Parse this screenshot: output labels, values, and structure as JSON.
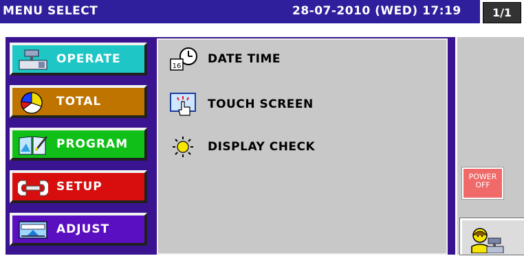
{
  "header": {
    "title": "MENU SELECT",
    "datetime": "28-07-2010 (WED) 17:19",
    "page": "1/1"
  },
  "menu": [
    {
      "id": "operate",
      "label": "OPERATE",
      "color": "#1ec6c6",
      "icon": "register-icon"
    },
    {
      "id": "total",
      "label": "TOTAL",
      "color": "#c07400",
      "icon": "pie-chart-icon"
    },
    {
      "id": "program",
      "label": "PROGRAM",
      "color": "#10c018",
      "icon": "book-pen-icon"
    },
    {
      "id": "setup",
      "label": "SETUP",
      "color": "#d80e0e",
      "icon": "wrench-icon"
    },
    {
      "id": "adjust",
      "label": "ADJUST",
      "color": "#5a0fc0",
      "icon": "keyboard-icon"
    }
  ],
  "items": [
    {
      "id": "date-time",
      "label": "DATE TIME",
      "icon": "clock-calendar-icon"
    },
    {
      "id": "touch-screen",
      "label": "TOUCH SCREEN",
      "icon": "touch-hand-icon"
    },
    {
      "id": "display-check",
      "label": "DISPLAY CHECK",
      "icon": "sun-icon"
    }
  ],
  "power": {
    "line1": "POWER",
    "line2": "OFF",
    "color": "#f06a6a"
  },
  "user": {
    "icon": "user-register-icon"
  }
}
